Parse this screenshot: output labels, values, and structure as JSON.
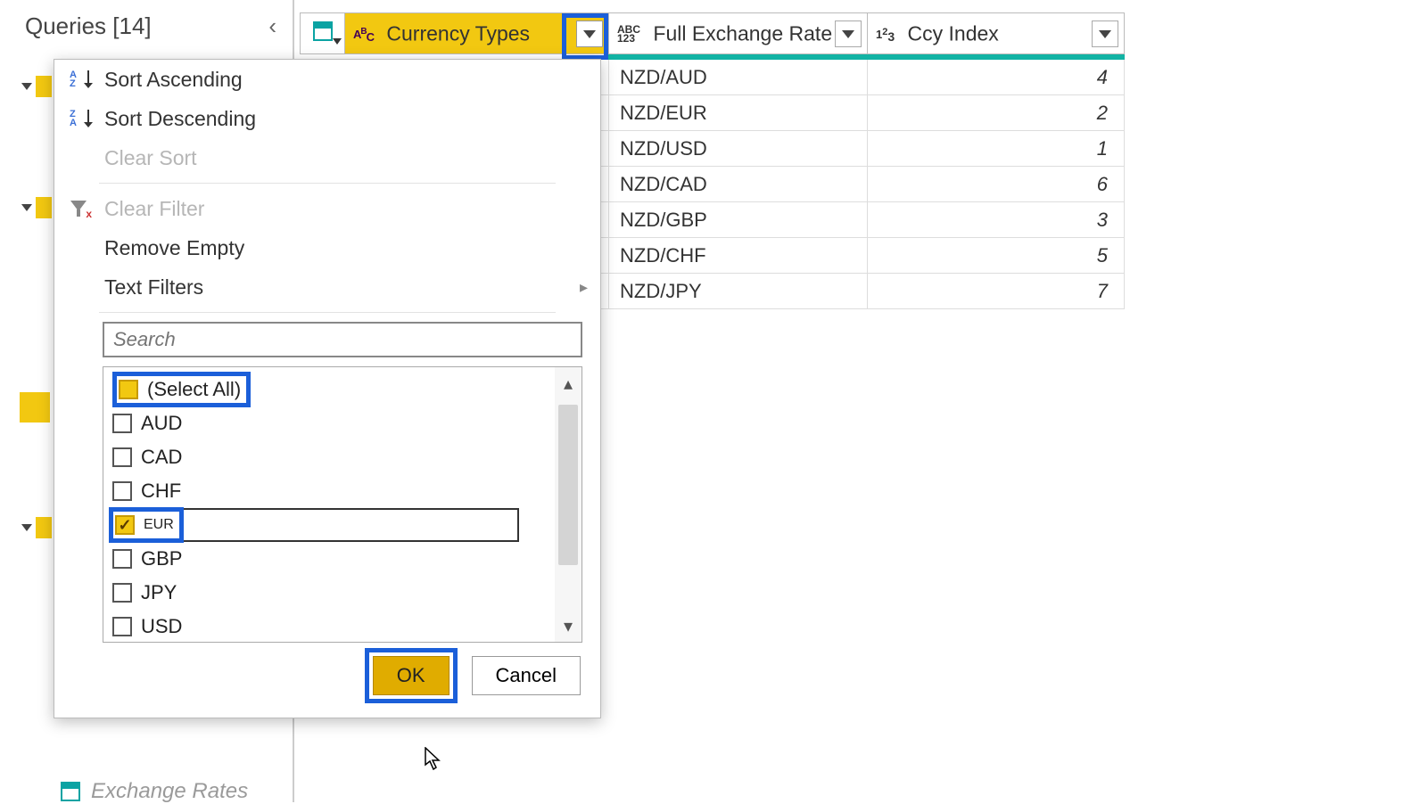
{
  "sidebar": {
    "header": "Queries [14]"
  },
  "columns": {
    "currency_types": "Currency Types",
    "full_exchange_rate": "Full Exchange Rate",
    "ccy_index": "Ccy Index"
  },
  "rows": [
    {
      "rate": "NZD/AUD",
      "idx": "4"
    },
    {
      "rate": "NZD/EUR",
      "idx": "2"
    },
    {
      "rate": "NZD/USD",
      "idx": "1"
    },
    {
      "rate": "NZD/CAD",
      "idx": "6"
    },
    {
      "rate": "NZD/GBP",
      "idx": "3"
    },
    {
      "rate": "NZD/CHF",
      "idx": "5"
    },
    {
      "rate": "NZD/JPY",
      "idx": "7"
    }
  ],
  "menu": {
    "sort_asc": "Sort Ascending",
    "sort_desc": "Sort Descending",
    "clear_sort": "Clear Sort",
    "clear_filter": "Clear Filter",
    "remove_empty": "Remove Empty",
    "text_filters": "Text Filters"
  },
  "search_placeholder": "Search",
  "filter_values": {
    "select_all": "(Select All)",
    "aud": "AUD",
    "cad": "CAD",
    "chf": "CHF",
    "eur": "EUR",
    "gbp": "GBP",
    "jpy": "JPY",
    "usd": "USD"
  },
  "buttons": {
    "ok": "OK",
    "cancel": "Cancel"
  },
  "bottom_query": "Exchange Rates"
}
